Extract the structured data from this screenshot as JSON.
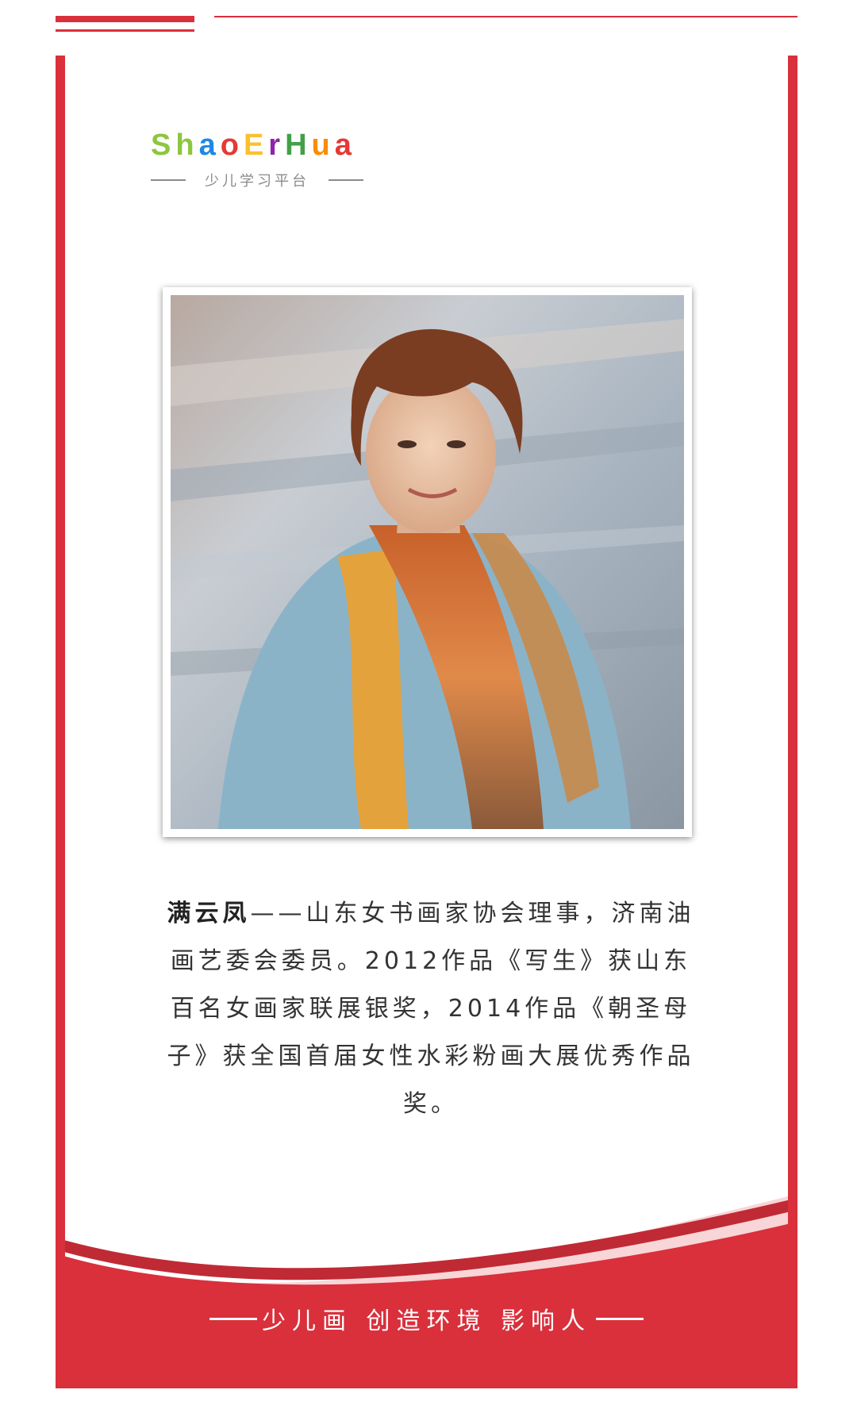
{
  "brand": {
    "logo_letters": [
      {
        "ch": "S",
        "color": "#8cc63f"
      },
      {
        "ch": "h",
        "color": "#8cc63f"
      },
      {
        "ch": "a",
        "color": "#1e88e5"
      },
      {
        "ch": "o",
        "color": "#e53935"
      },
      {
        "ch": "E",
        "color": "#fbc02d"
      },
      {
        "ch": "r",
        "color": "#8e24aa"
      },
      {
        "ch": "H",
        "color": "#43a047"
      },
      {
        "ch": "u",
        "color": "#fb8c00"
      },
      {
        "ch": "a",
        "color": "#e53935"
      }
    ],
    "subtitle": "少儿学习平台"
  },
  "profile": {
    "name": "满云凤",
    "bio": "——山东女书画家协会理事，济南油画艺委会委员。2012作品《写生》获山东百名女画家联展银奖，2014作品《朝圣母子》获全国首届女性水彩粉画大展优秀作品奖。"
  },
  "footer": {
    "slogan": "少儿画 创造环境 影响人"
  },
  "colors": {
    "accent_red": "#d9303c"
  }
}
